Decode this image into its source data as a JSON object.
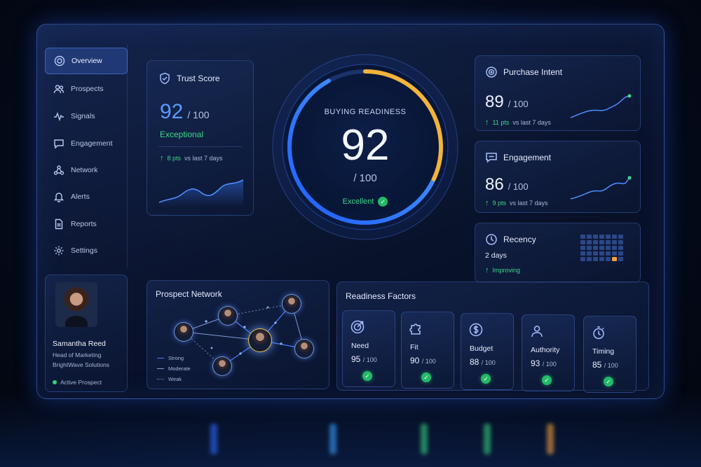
{
  "sidebar": {
    "items": [
      {
        "label": "Overview",
        "icon": "target-icon",
        "active": true
      },
      {
        "label": "Prospects",
        "icon": "users-icon"
      },
      {
        "label": "Signals",
        "icon": "activity-icon"
      },
      {
        "label": "Engagement",
        "icon": "chat-icon"
      },
      {
        "label": "Network",
        "icon": "network-icon"
      },
      {
        "label": "Alerts",
        "icon": "bell-icon"
      },
      {
        "label": "Reports",
        "icon": "document-icon"
      },
      {
        "label": "Settings",
        "icon": "gear-icon"
      }
    ]
  },
  "profile": {
    "name": "Samantha Reed",
    "role": "Head of Marketing",
    "company": "BrightWave Solutions",
    "status": "Active Prospect"
  },
  "trust": {
    "title": "Trust Score",
    "score": "92",
    "max": "/ 100",
    "label": "Exceptional",
    "delta_pts": "8 pts",
    "delta_text": "vs last 7 days"
  },
  "gauge": {
    "title": "BUYING READINESS",
    "score": "92",
    "max": "/ 100",
    "label": "Excellent",
    "value": 0.92
  },
  "purchase_intent": {
    "title": "Purchase Intent",
    "score": "89",
    "max": "/ 100",
    "delta_pts": "11 pts",
    "delta_text": "vs last 7 days"
  },
  "engagement": {
    "title": "Engagement",
    "score": "86",
    "max": "/ 100",
    "delta_pts": "9 pts",
    "delta_text": "vs last 7 days"
  },
  "recency": {
    "title": "Recency",
    "value": "2 days",
    "trend": "Improving"
  },
  "network": {
    "title": "Prospect Network",
    "legend": [
      "Strong",
      "Moderate",
      "Weak"
    ]
  },
  "factors": {
    "title": "Readiness Factors",
    "items": [
      {
        "name": "Need",
        "score": "95",
        "max": "/ 100",
        "icon": "target-icon"
      },
      {
        "name": "Fit",
        "score": "90",
        "max": "/ 100",
        "icon": "puzzle-icon"
      },
      {
        "name": "Budget",
        "score": "88",
        "max": "/ 100",
        "icon": "dollar-icon"
      },
      {
        "name": "Authority",
        "score": "93",
        "max": "/ 100",
        "icon": "person-icon"
      },
      {
        "name": "Timing",
        "score": "85",
        "max": "/ 100",
        "icon": "stopwatch-icon"
      }
    ]
  },
  "colors": {
    "accent": "#5b9bff",
    "positive": "#3fd98a",
    "gauge_end": "#f2b43a"
  }
}
